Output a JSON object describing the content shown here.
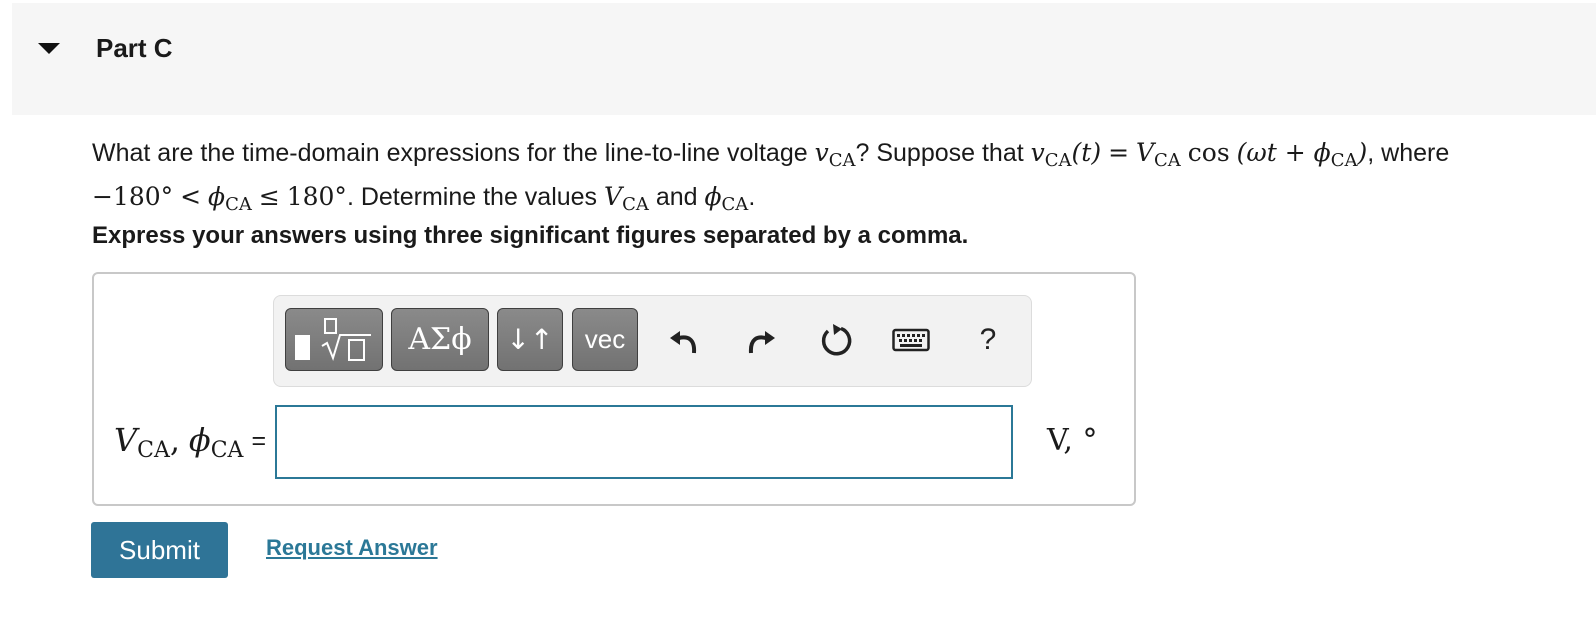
{
  "part": {
    "title": "Part C"
  },
  "question": {
    "text_1": "What are the time-domain expressions for the line-to-line voltage",
    "text_2": "? Suppose that",
    "text_3": ", where",
    "text_4": ". Determine the values",
    "text_5": "and",
    "text_6": ".",
    "v": "v",
    "V": "V",
    "phi": "ϕ",
    "sub_ca": "CA",
    "t_paren": "(t)",
    "eq": "=",
    "cos": "cos",
    "paren_open": "(",
    "omega_t_plus": "ωt +",
    "paren_close": ")",
    "minus_180": "−180°",
    "lt": "<",
    "le": "≤",
    "deg_180": "180°"
  },
  "instruction": "Express your answers using three significant figures separated by a comma.",
  "toolbar": {
    "greek_label": "ΑΣϕ",
    "arrows_label": "↓↑",
    "vec_label": "vec",
    "help_label": "?"
  },
  "answer": {
    "lhs_V": "V",
    "lhs_phi": "ϕ",
    "lhs_sub": "CA",
    "comma": ",",
    "equals": "=",
    "value": "",
    "units": "V, °"
  },
  "actions": {
    "submit_label": "Submit",
    "request_label": "Request Answer"
  },
  "colors": {
    "accent": "#2f7497",
    "link": "#2b7897",
    "header_bg": "#f6f6f6",
    "toolbar_button": "#7d7d7d"
  }
}
